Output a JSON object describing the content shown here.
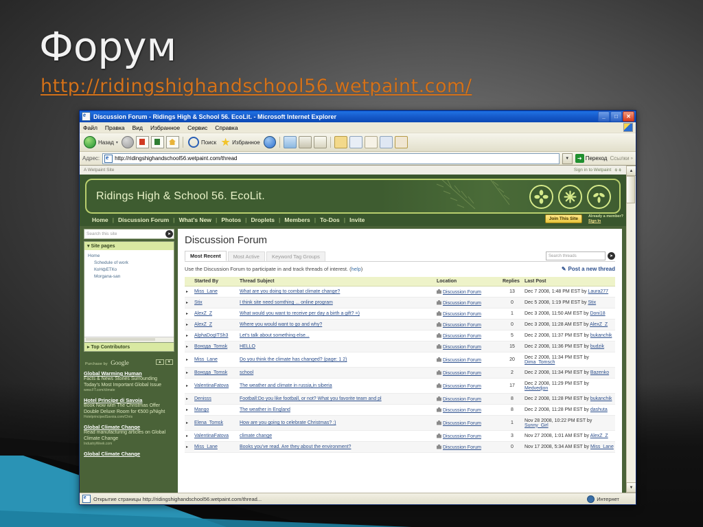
{
  "slide": {
    "title": "Форум",
    "url": "http://ridingshighandschool56.wetpaint.com/"
  },
  "browser": {
    "window_title": "Discussion Forum - Ridings High & School 56. EcoLit. - Microsoft Internet Explorer",
    "minimize_label": "_",
    "maximize_label": "□",
    "close_label": "✕",
    "menu": [
      "Файл",
      "Правка",
      "Вид",
      "Избранное",
      "Сервис",
      "Справка"
    ],
    "toolbar": {
      "back_label": "Назад",
      "forward_label": "",
      "search_label": "Поиск",
      "favorites_label": "Избранное"
    },
    "address": {
      "label": "Адрес:",
      "value": "http://ridingshighandschool56.wetpaint.com/thread",
      "go_label": "Переход",
      "links_label": "Ссылки"
    },
    "status": {
      "text": "Открытие страницы http://ridingshighandschool56.wetpaint.com/thread...",
      "zone": "Интернет"
    }
  },
  "site": {
    "top_left": "A Wetpaint Site",
    "sign_in": "Sign in to Wetpaint",
    "banner_title": "Ridings High & School 56. EcoLit.",
    "nav": [
      "Home",
      "Discussion Forum",
      "What's New",
      "Photos",
      "Droplets",
      "Members",
      "To-Dos",
      "Invite"
    ],
    "join_button": "Join This Site",
    "member_prompt": "Already a member?",
    "member_signin": "Sign In"
  },
  "sidebar": {
    "search_placeholder": "Search this site",
    "site_pages_header": "Site pages",
    "site_pages": [
      {
        "label": "Home",
        "sub": false
      },
      {
        "label": "Schedule of work",
        "sub": true
      },
      {
        "label": "КоНфЕТКо",
        "sub": true
      },
      {
        "label": "Morgana-san",
        "sub": true
      }
    ],
    "top_contributors_header": "Top Contributors",
    "ads_by": "Purchase by",
    "ads_brand": "Google",
    "ads": [
      {
        "title": "Global Warming Human",
        "desc": "Facts & News Stories Surrounding Today's Most Important Global Issue",
        "url": "www.FT.com/climate"
      },
      {
        "title": "Hotel Principe di Savoia",
        "desc": "Book Now with The Christmas Offer Double Deluxe Room for €500 p/Night",
        "url": "HotelprincipedSavoia.com/Chris"
      },
      {
        "title": "Global Climate Change",
        "desc": "Read manufacturing articles on Global Climate Change",
        "url": "IndustryWeek.com"
      },
      {
        "title": "Global Climate Change",
        "desc": "",
        "url": ""
      }
    ]
  },
  "forum": {
    "heading": "Discussion Forum",
    "tabs": [
      {
        "label": "Most Recent",
        "active": true
      },
      {
        "label": "Most Active",
        "active": false
      },
      {
        "label": "Keyword Tag Groups",
        "active": false
      }
    ],
    "thread_search_placeholder": "Search threads",
    "intro_text": "Use the Discussion Forum to participate in and track threads of interest. (",
    "intro_help": "help",
    "intro_text_end": ")",
    "post_new_thread": "Post a new thread",
    "columns": [
      "",
      "Started By",
      "Thread Subject",
      "Location",
      "Replies",
      "Last Post"
    ],
    "rows": [
      {
        "by": "Miss_Lane",
        "subject": "What are you doing to combat climate change?",
        "location": "Discussion Forum",
        "replies": "13",
        "last_post": "Dec 7 2008, 1:48 PM EST by ",
        "last_by": "Laura277"
      },
      {
        "by": "Stix",
        "subject": "I think site need somthing ... online program",
        "location": "Discussion Forum",
        "replies": "0",
        "last_post": "Dec 5 2008, 1:19 PM EST by ",
        "last_by": "Stix"
      },
      {
        "by": "AlexZ_Z",
        "subject": "What would you want to receive per day a birth a gift? =)",
        "location": "Discussion Forum",
        "replies": "1",
        "last_post": "Dec 3 2008, 11:50 AM EST by ",
        "last_by": "Doni18"
      },
      {
        "by": "AlexZ_Z",
        "subject": "Where you would want to go and why?",
        "location": "Discussion Forum",
        "replies": "0",
        "last_post": "Dec 3 2008, 11:28 AM EST by ",
        "last_by": "AlexZ_Z"
      },
      {
        "by": "AlphaDogITSh3",
        "subject": "Let's talk about something else...",
        "location": "Discussion Forum",
        "replies": "5",
        "last_post": "Dec 2 2008, 11:37 PM EST by ",
        "last_by": "bukanchik"
      },
      {
        "by": "Вонода_Tomsk",
        "subject": "HELLO",
        "location": "Discussion Forum",
        "replies": "15",
        "last_post": "Dec 2 2008, 11:36 PM EST by ",
        "last_by": "budzik"
      },
      {
        "by": "Miss_Lane",
        "subject": "Do you think the climate has changed? (page: 1 2)",
        "location": "Discussion Forum",
        "replies": "20",
        "last_post": "Dec 2 2008, 11:34 PM EST by ",
        "last_by": "Dima_Tomsch"
      },
      {
        "by": "Вонода_Tomsk",
        "subject": "school",
        "location": "Discussion Forum",
        "replies": "2",
        "last_post": "Dec 2 2008, 11:34 PM EST by ",
        "last_by": "Bazenko"
      },
      {
        "by": "ValentinaFatova",
        "subject": "The weather and climate in russia,in siberia",
        "location": "Discussion Forum",
        "replies": "17",
        "last_post": "Dec 2 2008, 11:29 PM EST by ",
        "last_by": "Medvedjon"
      },
      {
        "by": "Denisss",
        "subject": "Football:Do you like football, or not? What you favorite team and pl",
        "location": "Discussion Forum",
        "replies": "8",
        "last_post": "Dec 2 2008, 11:28 PM EST by ",
        "last_by": "bukanchik"
      },
      {
        "by": "Mango",
        "subject": "The weather in England",
        "location": "Discussion Forum",
        "replies": "8",
        "last_post": "Dec 2 2008, 11:28 PM EST by ",
        "last_by": "dashuta"
      },
      {
        "by": "Elena_Tomsk",
        "subject": "How are you going to celebrate Christmas? :)",
        "location": "Discussion Forum",
        "replies": "1",
        "last_post": "Nov 28 2008, 10:22 PM EST by ",
        "last_by": "Sunny_Girl"
      },
      {
        "by": "ValentinaFatova",
        "subject": "climate change",
        "location": "Discussion Forum",
        "replies": "3",
        "last_post": "Nov 27 2008, 1:01 AM EST by ",
        "last_by": "AlexZ_Z"
      },
      {
        "by": "Miss_Lane",
        "subject": "Books you've read. Are they about the environment?",
        "location": "Discussion Forum",
        "replies": "0",
        "last_post": "Nov 17 2008, 5:34 AM EST by ",
        "last_by": "Miss_Lane"
      }
    ]
  }
}
